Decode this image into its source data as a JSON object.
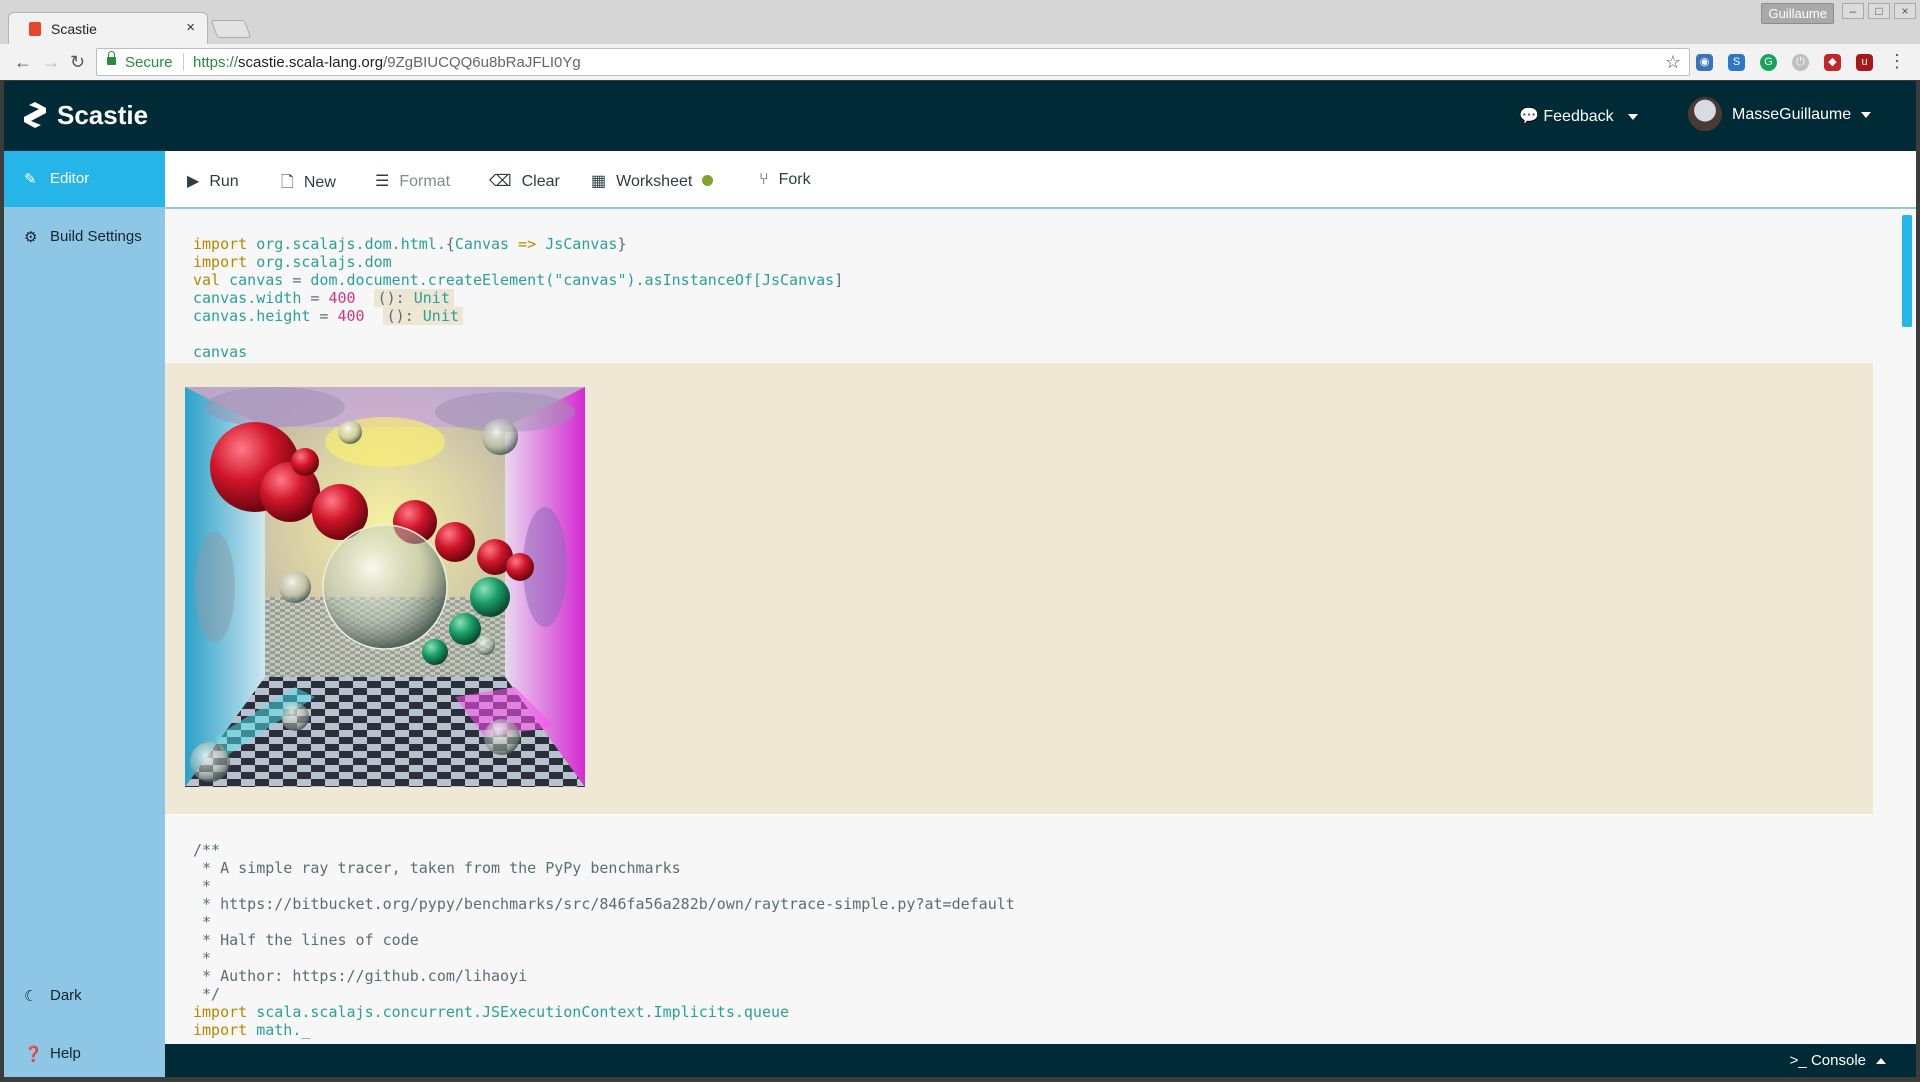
{
  "browser": {
    "tab_title": "Scastie",
    "tab_close": "×",
    "profile_name": "Guillaume",
    "url_scheme": "https://",
    "url_host": "scastie.scala-lang.org",
    "url_path": "/9ZgBIUCQQ6u8bRaJFLI0Yg",
    "secure_label": "Secure"
  },
  "app": {
    "brand": "Scastie",
    "feedback_label": "Feedback",
    "user_name": "MasseGuillaume"
  },
  "sidebar": {
    "items": [
      {
        "label": "Editor",
        "icon": "edit-icon"
      },
      {
        "label": "Build Settings",
        "icon": "gear-icon"
      },
      {
        "label": "Dark",
        "icon": "moon-icon"
      },
      {
        "label": "Help",
        "icon": "question-icon"
      }
    ]
  },
  "toolbar": {
    "run": "Run",
    "new": "New",
    "format": "Format",
    "clear": "Clear",
    "worksheet": "Worksheet",
    "fork": "Fork"
  },
  "editor": {
    "line1_kw": "import",
    "line1_pkg": "org.scalajs.dom.html.",
    "line1_rest_open": "{",
    "line1_canvas": "Canvas",
    "line1_arrow": " => ",
    "line1_js": "JsCanvas",
    "line1_close": "}",
    "line2_kw": "import",
    "line2_pkg": "org.scalajs.dom",
    "line3_kw": "val",
    "line3_name": "canvas",
    "line3_eq": " = ",
    "line3_call": "dom.document.createElement(",
    "line3_str": "\"canvas\"",
    "line3_as": ").asInstanceOf[",
    "line3_type": "JsCanvas",
    "line3_end": "]",
    "line4_prop": "canvas.width",
    "line4_eq": " = ",
    "line4_num": "400",
    "line5_prop": "canvas.height",
    "line5_eq": " = ",
    "line5_num": "400",
    "hint_unit_paren": "(): ",
    "hint_unit_type": "Unit",
    "line7": "canvas",
    "comment_lines": [
      "/**",
      " * A simple ray tracer, taken from the PyPy benchmarks",
      " *",
      " * https://bitbucket.org/pypy/benchmarks/src/846fa56a282b/own/raytrace-simple.py?at=default",
      " *",
      " * Half the lines of code",
      " *",
      " * Author: https://github.com/lihaoyi",
      " */"
    ],
    "import3_kw": "import",
    "import3_pkg": "scala.scalajs.concurrent.JSExecutionContext.Implicits.queue",
    "import4_kw": "import",
    "import4_pkg": "math._"
  },
  "console": {
    "label": "Console",
    "prompt": ">_"
  },
  "colors": {
    "topbar": "#002b36",
    "sidebar": "#8ec7e6",
    "active": "#26b5e8",
    "output_bg": "#eee8d5",
    "worksheet_dot": "#85a32c"
  }
}
